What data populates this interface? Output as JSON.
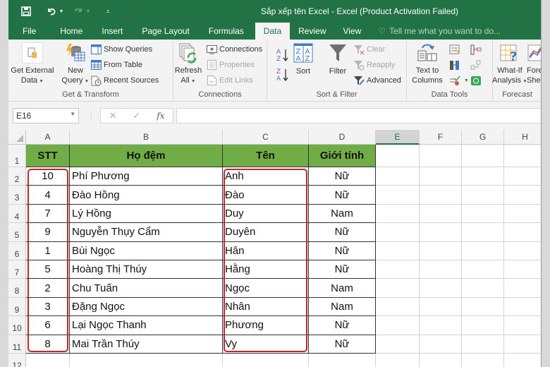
{
  "window": {
    "title": "Sắp xếp tên Excel - Excel (Product Activation Failed)",
    "accent": "#217346"
  },
  "qat": {
    "save": "save-icon",
    "undo": "undo-icon",
    "redo": "redo-icon",
    "customize": "customize-qat-icon"
  },
  "tabs": [
    {
      "label": "File"
    },
    {
      "label": "Home"
    },
    {
      "label": "Insert"
    },
    {
      "label": "Page Layout"
    },
    {
      "label": "Formulas"
    },
    {
      "label": "Data",
      "active": true
    },
    {
      "label": "Review"
    },
    {
      "label": "View"
    }
  ],
  "tell_me": "Tell me what you want to do...",
  "ribbon": {
    "get_transform": {
      "label": "Get & Transform",
      "get_external_data": [
        "Get External",
        "Data"
      ],
      "new_query": [
        "New",
        "Query"
      ],
      "show_queries": "Show Queries",
      "from_table": "From Table",
      "recent_sources": "Recent Sources"
    },
    "connections": {
      "label": "Connections",
      "refresh_all": [
        "Refresh",
        "All"
      ],
      "connections": "Connections",
      "properties": "Properties",
      "edit_links": "Edit Links"
    },
    "sort_filter": {
      "label": "Sort & Filter",
      "sort_az": "A→Z",
      "sort_za": "Z→A",
      "sort": "Sort",
      "filter": "Filter",
      "clear": "Clear",
      "reapply": "Reapply",
      "advanced": "Advanced"
    },
    "data_tools": {
      "label": "Data Tools",
      "text_to_columns": [
        "Text to",
        "Columns"
      ]
    },
    "forecast": {
      "label": "Forecast",
      "what_if": [
        "What-If",
        "Analysis"
      ],
      "forecast_sheet": [
        "Forec",
        "Shee"
      ]
    }
  },
  "formula_bar": {
    "name_box": "E16",
    "cancel": "✕",
    "enter": "✓",
    "fx": "fx",
    "formula": ""
  },
  "sheet": {
    "columns": [
      "A",
      "B",
      "C",
      "D",
      "E",
      "F",
      "G",
      "H"
    ],
    "selected_column": "E",
    "header_fill": "#70ad47",
    "highlight_color": "#c0272d",
    "headers": [
      "STT",
      "Họ đệm",
      "Tên",
      "Giới tính"
    ],
    "rows": [
      {
        "row": "2",
        "stt": "10",
        "ho_dem": "Phí Phương",
        "ten": "Anh",
        "gioi_tinh": "Nữ"
      },
      {
        "row": "3",
        "stt": "4",
        "ho_dem": "Đào Hồng",
        "ten": "Đào",
        "gioi_tinh": "Nữ"
      },
      {
        "row": "4",
        "stt": "7",
        "ho_dem": "Lý Hồng",
        "ten": "Duy",
        "gioi_tinh": "Nam"
      },
      {
        "row": "5",
        "stt": "9",
        "ho_dem": "Nguyễn Thụy Cẩm",
        "ten": "Duyên",
        "gioi_tinh": "Nữ"
      },
      {
        "row": "6",
        "stt": "1",
        "ho_dem": "Bùi Ngọc",
        "ten": "Hân",
        "gioi_tinh": "Nữ"
      },
      {
        "row": "7",
        "stt": "5",
        "ho_dem": "Hoàng Thị Thúy",
        "ten": "Hằng",
        "gioi_tinh": "Nữ"
      },
      {
        "row": "8",
        "stt": "2",
        "ho_dem": "Chu Tuấn",
        "ten": "Ngọc",
        "gioi_tinh": "Nam"
      },
      {
        "row": "9",
        "stt": "3",
        "ho_dem": "Đặng Ngọc",
        "ten": "Nhân",
        "gioi_tinh": "Nam"
      },
      {
        "row": "10",
        "stt": "6",
        "ho_dem": "Lại Ngọc Thanh",
        "ten": "Phương",
        "gioi_tinh": "Nữ"
      },
      {
        "row": "11",
        "stt": "8",
        "ho_dem": "Mai Trần Thúy",
        "ten": "Vy",
        "gioi_tinh": "Nữ"
      }
    ],
    "row_labels": [
      "1",
      "12"
    ]
  }
}
